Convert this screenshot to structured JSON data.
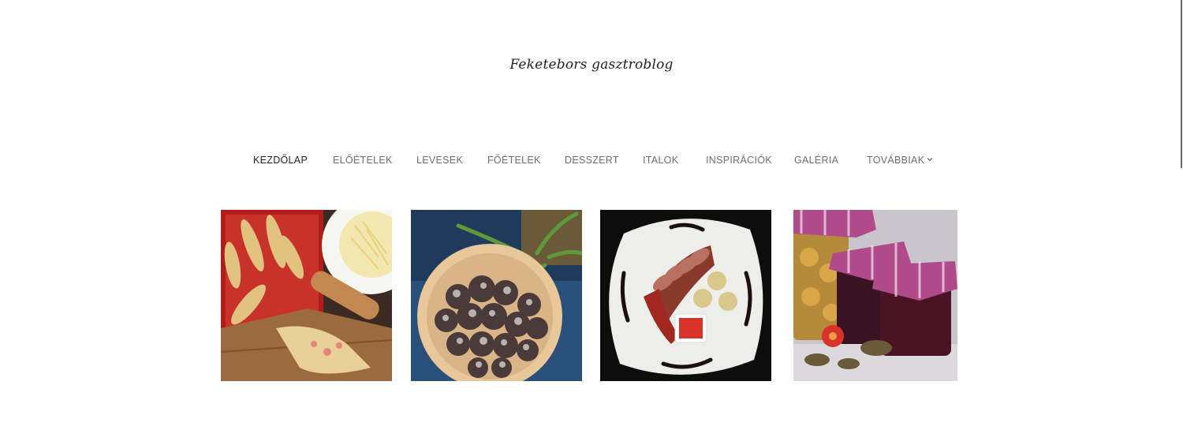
{
  "site": {
    "title": "Feketebors gasztroblog"
  },
  "nav": {
    "items": [
      {
        "label": "KEZDŐLAP",
        "active": true
      },
      {
        "label": "ELŐÉTELEK"
      },
      {
        "label": "LEVESEK"
      },
      {
        "label": "FŐÉTELEK"
      },
      {
        "label": "DESSZERT"
      },
      {
        "label": "ITALOK"
      },
      {
        "label": "INSPIRÁCIÓK"
      },
      {
        "label": "GALÉRIA"
      },
      {
        "label": "TOVÁBBIAK",
        "dropdown": true
      }
    ]
  },
  "gallery": {
    "images": [
      {
        "subject": "filled-dough-crescents-photo"
      },
      {
        "subject": "chocolate-crinkle-cookies-photo"
      },
      {
        "subject": "sliced-meat-plate-photo"
      },
      {
        "subject": "preserves-jars-photo"
      }
    ]
  },
  "colors": {
    "text_dark": "#222222",
    "text_nav": "#6e6e6e",
    "background": "#ffffff"
  }
}
